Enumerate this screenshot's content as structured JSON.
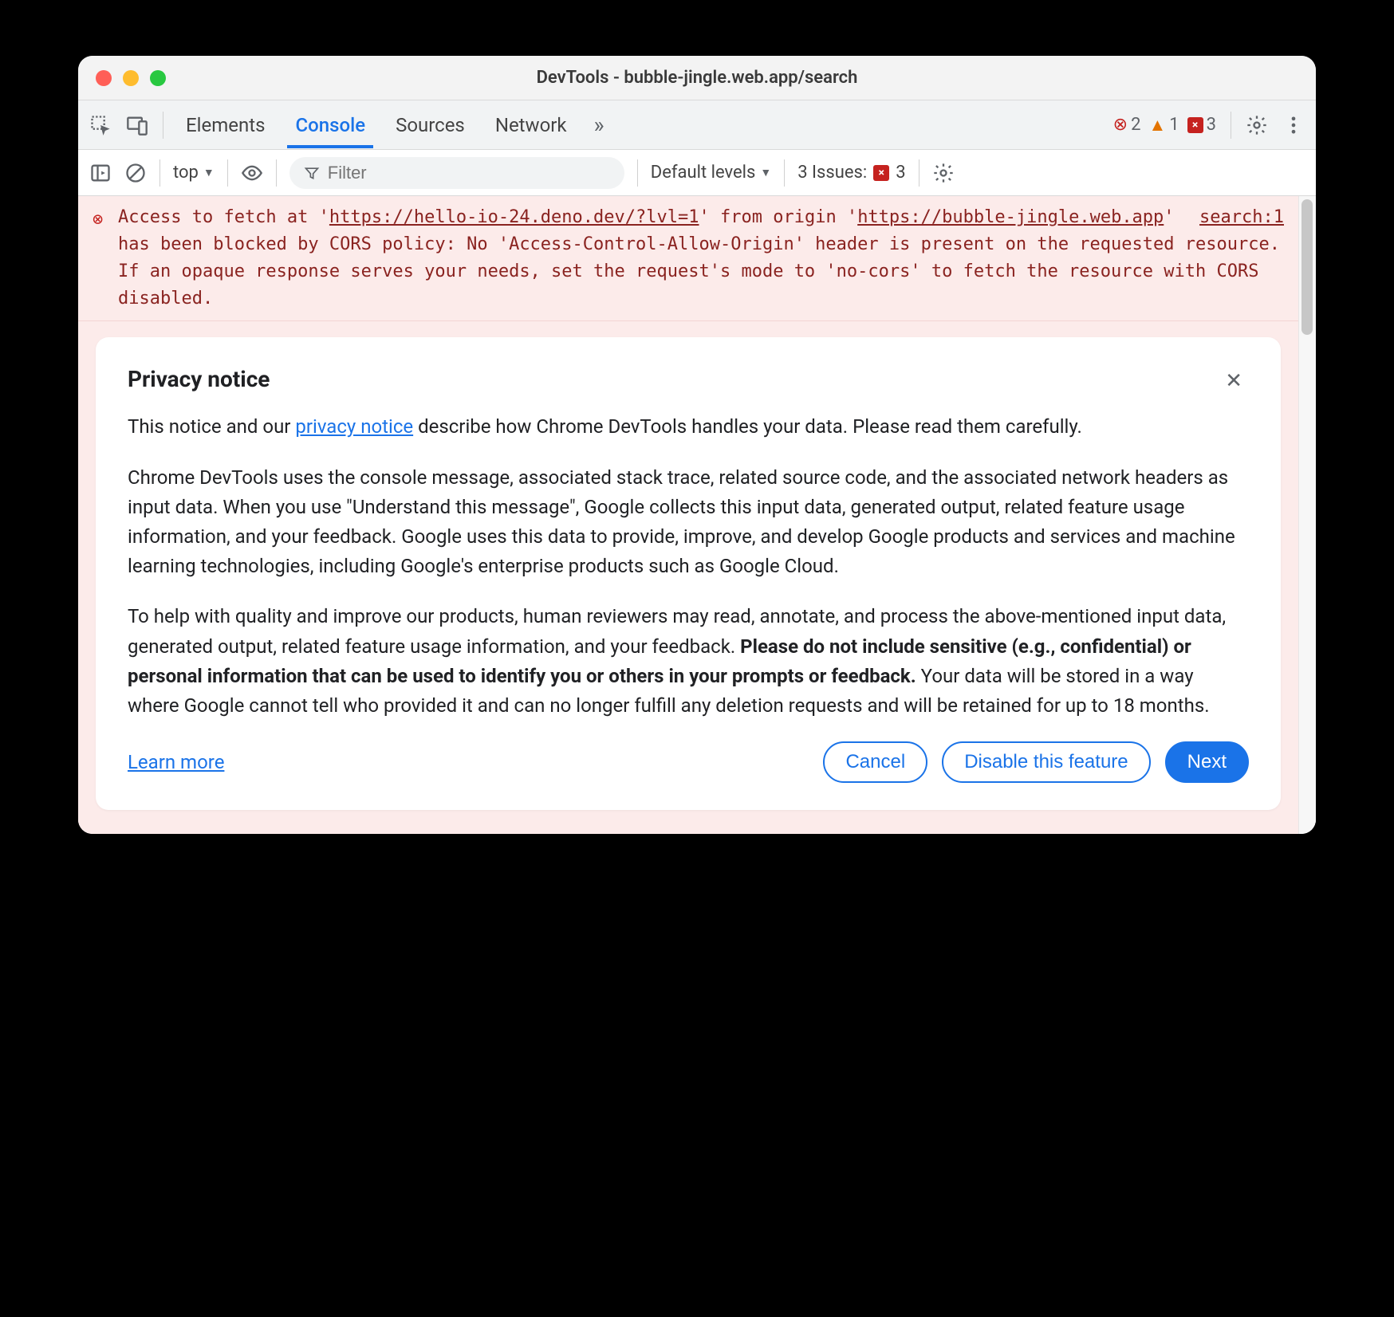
{
  "window": {
    "title": "DevTools - bubble-jingle.web.app/search"
  },
  "tabs": {
    "elements": "Elements",
    "console": "Console",
    "sources": "Sources",
    "network": "Network"
  },
  "status": {
    "errors": "2",
    "warnings": "1",
    "messages": "3"
  },
  "subbar": {
    "context": "top",
    "filter_placeholder": "Filter",
    "levels": "Default levels",
    "issues_label": "3 Issues:",
    "issues_count": "3"
  },
  "error": {
    "prefix": "Access to fetch at '",
    "url1": "https://hello-io-24.deno.dev/?lvl=1",
    "mid1": "' from origin '",
    "url2": "https://bubble-jingle.web.app",
    "rest": "' has been blocked by CORS policy: No 'Access-Control-Allow-Origin' header is present on the requested resource. If an opaque response serves your needs, set the request's mode to 'no-cors' to fetch the resource with CORS disabled.",
    "source_ref": "search:1"
  },
  "privacy": {
    "title": "Privacy notice",
    "intro_a": "This notice and our ",
    "intro_link": "privacy notice",
    "intro_b": " describe how Chrome DevTools handles your data. Please read them carefully.",
    "para2": "Chrome DevTools uses the console message, associated stack trace, related source code, and the associated network headers as input data. When you use \"Understand this message\", Google collects this input data, generated output, related feature usage information, and your feedback. Google uses this data to provide, improve, and develop Google products and services and machine learning technologies, including Google's enterprise products such as Google Cloud.",
    "para3_a": "To help with quality and improve our products, human reviewers may read, annotate, and process the above-mentioned input data, generated output, related feature usage information, and your feedback. ",
    "para3_bold": "Please do not include sensitive (e.g., confidential) or personal information that can be used to identify you or others in your prompts or feedback.",
    "para3_b": " Your data will be stored in a way where Google cannot tell who provided it and can no longer fulfill any deletion requests and will be retained for up to 18 months.",
    "learn_more": "Learn more",
    "cancel": "Cancel",
    "disable": "Disable this feature",
    "next": "Next"
  }
}
